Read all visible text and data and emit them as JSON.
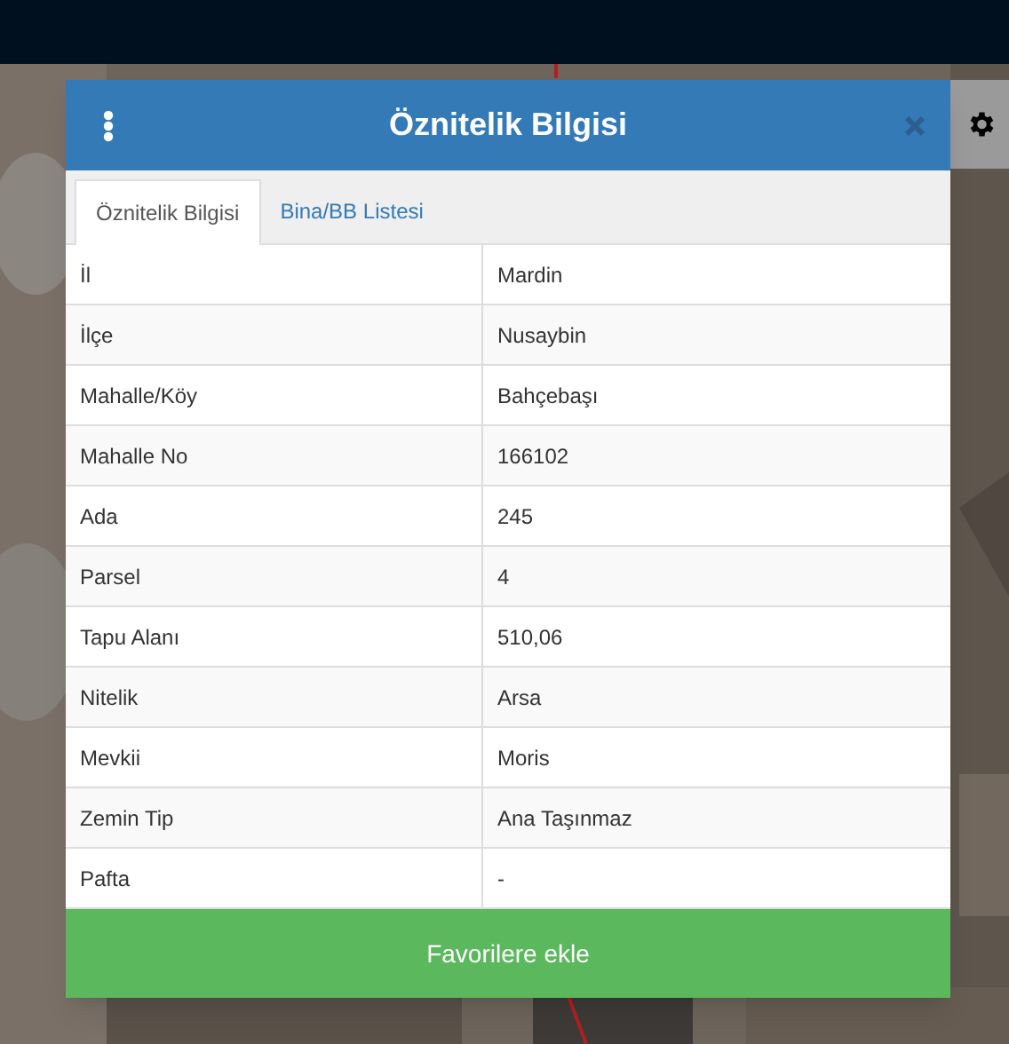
{
  "dialog": {
    "title": "Öznitelik Bilgisi"
  },
  "tabs": [
    {
      "label": "Öznitelik Bilgisi",
      "selected": true
    },
    {
      "label": "Bina/BB Listesi",
      "selected": false
    }
  ],
  "table": {
    "rows": [
      {
        "label": "İl",
        "value": "Mardin"
      },
      {
        "label": "İlçe",
        "value": "Nusaybin"
      },
      {
        "label": "Mahalle/Köy",
        "value": "Bahçebaşı"
      },
      {
        "label": "Mahalle No",
        "value": "166102"
      },
      {
        "label": "Ada",
        "value": "245"
      },
      {
        "label": "Parsel",
        "value": "4"
      },
      {
        "label": "Tapu Alanı",
        "value": "510,06"
      },
      {
        "label": "Nitelik",
        "value": "Arsa"
      },
      {
        "label": "Mevkii",
        "value": "Moris"
      },
      {
        "label": "Zemin Tip",
        "value": "Ana Taşınmaz"
      },
      {
        "label": "Pafta",
        "value": "-"
      }
    ]
  },
  "footer_button": "Favorilere ekle"
}
